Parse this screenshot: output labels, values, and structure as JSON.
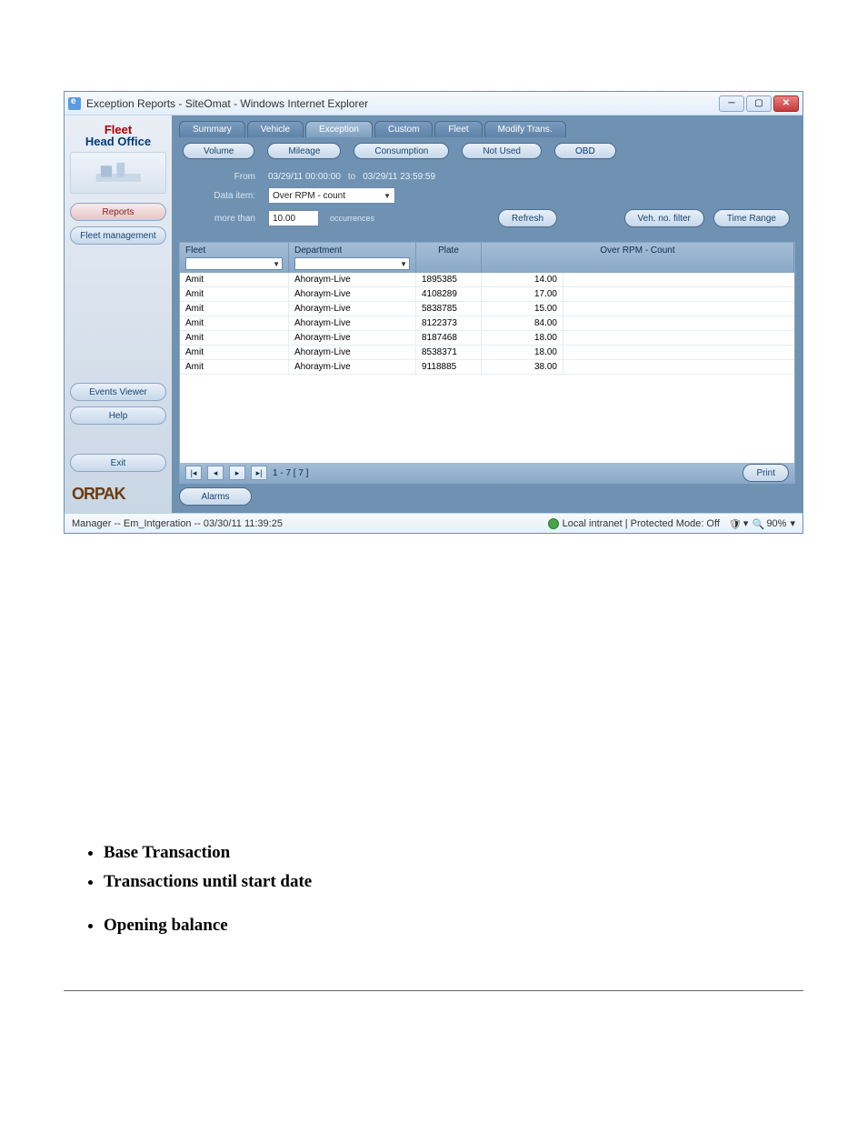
{
  "window": {
    "title": "Exception Reports - SiteOmat - Windows Internet Explorer"
  },
  "sidebar": {
    "brand_line1": "Fleet",
    "brand_line2": "Head Office",
    "items": [
      {
        "label": "Reports",
        "active": true
      },
      {
        "label": "Fleet management",
        "active": false
      },
      {
        "label": "Events Viewer",
        "active": false
      },
      {
        "label": "Help",
        "active": false
      },
      {
        "label": "Exit",
        "active": false
      }
    ],
    "logo": "ORPAK"
  },
  "tabs": {
    "items": [
      {
        "label": "Summary"
      },
      {
        "label": "Vehicle"
      },
      {
        "label": "Exception",
        "active": true
      },
      {
        "label": "Custom"
      },
      {
        "label": "Fleet"
      },
      {
        "label": "Modify Trans."
      }
    ]
  },
  "subtabs": {
    "items": [
      {
        "label": "Volume"
      },
      {
        "label": "Mileage"
      },
      {
        "label": "Consumption"
      },
      {
        "label": "Not Used"
      },
      {
        "label": "OBD",
        "active": true
      }
    ]
  },
  "filters": {
    "from_label": "From",
    "from_value": "03/29/11 00:00:00",
    "to_label": "to",
    "to_value": "03/29/11 23:59:59",
    "data_item_label": "Data item:",
    "data_item_value": "Over RPM - count",
    "more_than_label": "more than",
    "more_than_value": "10.00",
    "occurrences_label": "occurrences",
    "refresh": "Refresh",
    "veh_filter": "Veh. no. filter",
    "time_range": "Time Range"
  },
  "grid": {
    "headers": {
      "fleet": "Fleet",
      "department": "Department",
      "plate": "Plate",
      "metric": "Over RPM - Count"
    },
    "rows": [
      {
        "fleet": "Amit",
        "dept": "Ahoraym-Live",
        "plate": "1895385",
        "val": "14.00"
      },
      {
        "fleet": "Amit",
        "dept": "Ahoraym-Live",
        "plate": "4108289",
        "val": "17.00"
      },
      {
        "fleet": "Amit",
        "dept": "Ahoraym-Live",
        "plate": "5838785",
        "val": "15.00"
      },
      {
        "fleet": "Amit",
        "dept": "Ahoraym-Live",
        "plate": "8122373",
        "val": "84.00"
      },
      {
        "fleet": "Amit",
        "dept": "Ahoraym-Live",
        "plate": "8187468",
        "val": "18.00"
      },
      {
        "fleet": "Amit",
        "dept": "Ahoraym-Live",
        "plate": "8538371",
        "val": "18.00"
      },
      {
        "fleet": "Amit",
        "dept": "Ahoraym-Live",
        "plate": "9118885",
        "val": "38.00"
      }
    ]
  },
  "pager": {
    "range": "1 - 7 [ 7 ]",
    "print": "Print"
  },
  "alarms_btn": "Alarms",
  "statusbar": {
    "left": "Manager -- Em_Intgeration -- 03/30/11 11:39:25",
    "mode": "Local intranet | Protected Mode: Off",
    "zoom": "90%"
  },
  "doc": {
    "bullets": [
      "Base Transaction",
      "Transactions until start date",
      "Opening balance"
    ]
  }
}
